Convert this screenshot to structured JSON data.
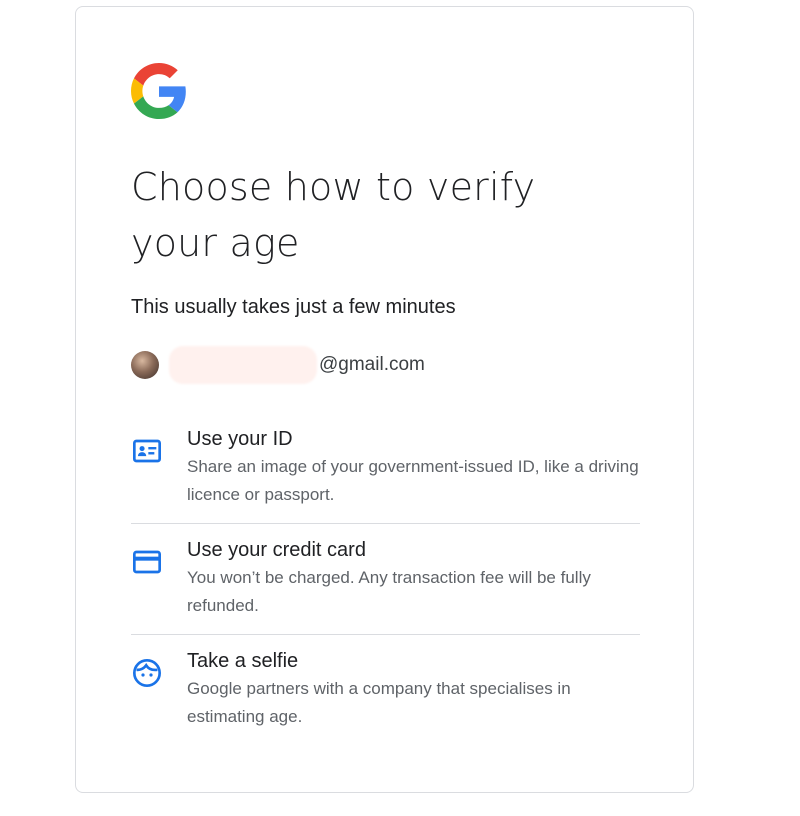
{
  "brand": {
    "logo_icon": "google-g-logo",
    "colors": {
      "blue": "#4285F4",
      "red": "#EA4335",
      "yellow": "#FBBC05",
      "green": "#34A853",
      "icon_blue": "#1a73e8"
    }
  },
  "page": {
    "title": "Choose how to verify your age",
    "subtitle": "This usually takes just a few minutes"
  },
  "account": {
    "avatar_icon": "user-avatar",
    "email_domain": "@gmail.com"
  },
  "options": [
    {
      "icon": "id-card-icon",
      "title": "Use your ID",
      "description": "Share an image of your government-issued ID, like a driving licence or passport."
    },
    {
      "icon": "credit-card-icon",
      "title": "Use your credit card",
      "description": "You won’t be charged. Any transaction fee will be fully refunded."
    },
    {
      "icon": "face-icon",
      "title": "Take a selfie",
      "description": "Google partners with a company that specialises in estimating age."
    }
  ]
}
